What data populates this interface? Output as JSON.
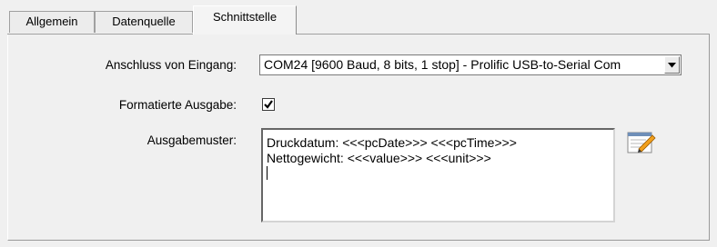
{
  "tabs": [
    {
      "label": "Allgemein",
      "active": false
    },
    {
      "label": "Datenquelle",
      "active": false
    },
    {
      "label": "Schnittstelle",
      "active": true
    }
  ],
  "form": {
    "connection": {
      "label": "Anschluss von Eingang:",
      "value": "COM24 [9600 Baud, 8 bits, 1 stop] - Prolific USB-to-Serial Com"
    },
    "formatted": {
      "label": "Formatierte Ausgabe:",
      "checked": true
    },
    "pattern": {
      "label": "Ausgabemuster:",
      "lines": [
        "Druckdatum: <<<pcDate>>> <<<pcTime>>>",
        "Nettogewicht: <<<value>>> <<<unit>>>"
      ]
    }
  },
  "icons": {
    "dropdown": "chevron-down-icon",
    "checkmark": "checkmark-icon",
    "edit": "edit-notepad-icon"
  }
}
